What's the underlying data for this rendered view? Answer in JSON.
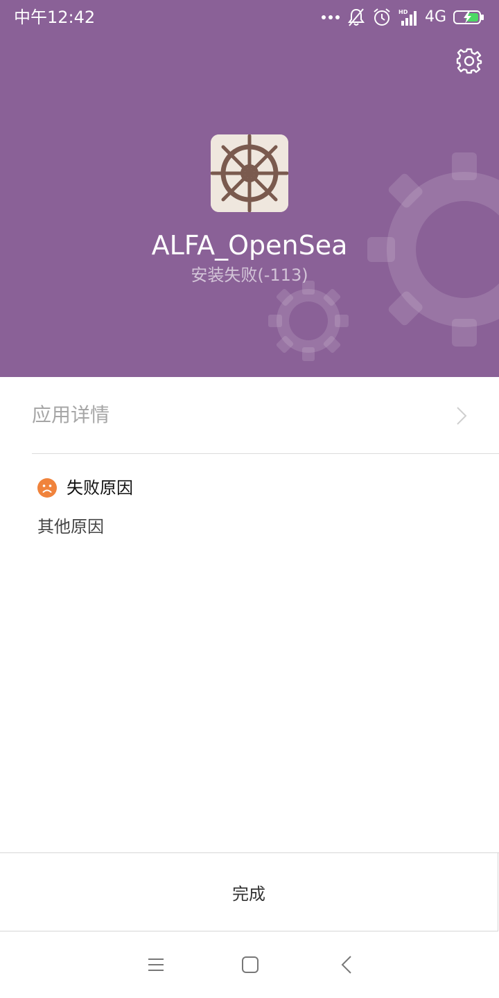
{
  "status_bar": {
    "time": "中午12:42",
    "network": "4G",
    "icons": [
      "more-dots-icon",
      "notifications-muted-icon",
      "alarm-icon",
      "hd-signal-icon",
      "battery-charging-icon"
    ]
  },
  "header": {
    "app_name": "ALFA_OpenSea",
    "install_status": "安装失败(-113)",
    "background_color": "#8a6197",
    "settings_icon": "gear-icon",
    "app_icon": "ship-wheel-icon"
  },
  "details": {
    "label": "应用详情",
    "chevron_icon": "chevron-right-icon"
  },
  "failure": {
    "title": "失败原因",
    "icon": "sad-face-icon",
    "icon_color": "#f0833c",
    "reason": "其他原因"
  },
  "footer": {
    "done_label": "完成"
  },
  "nav": {
    "icons": [
      "menu-icon",
      "home-icon",
      "back-icon"
    ]
  }
}
